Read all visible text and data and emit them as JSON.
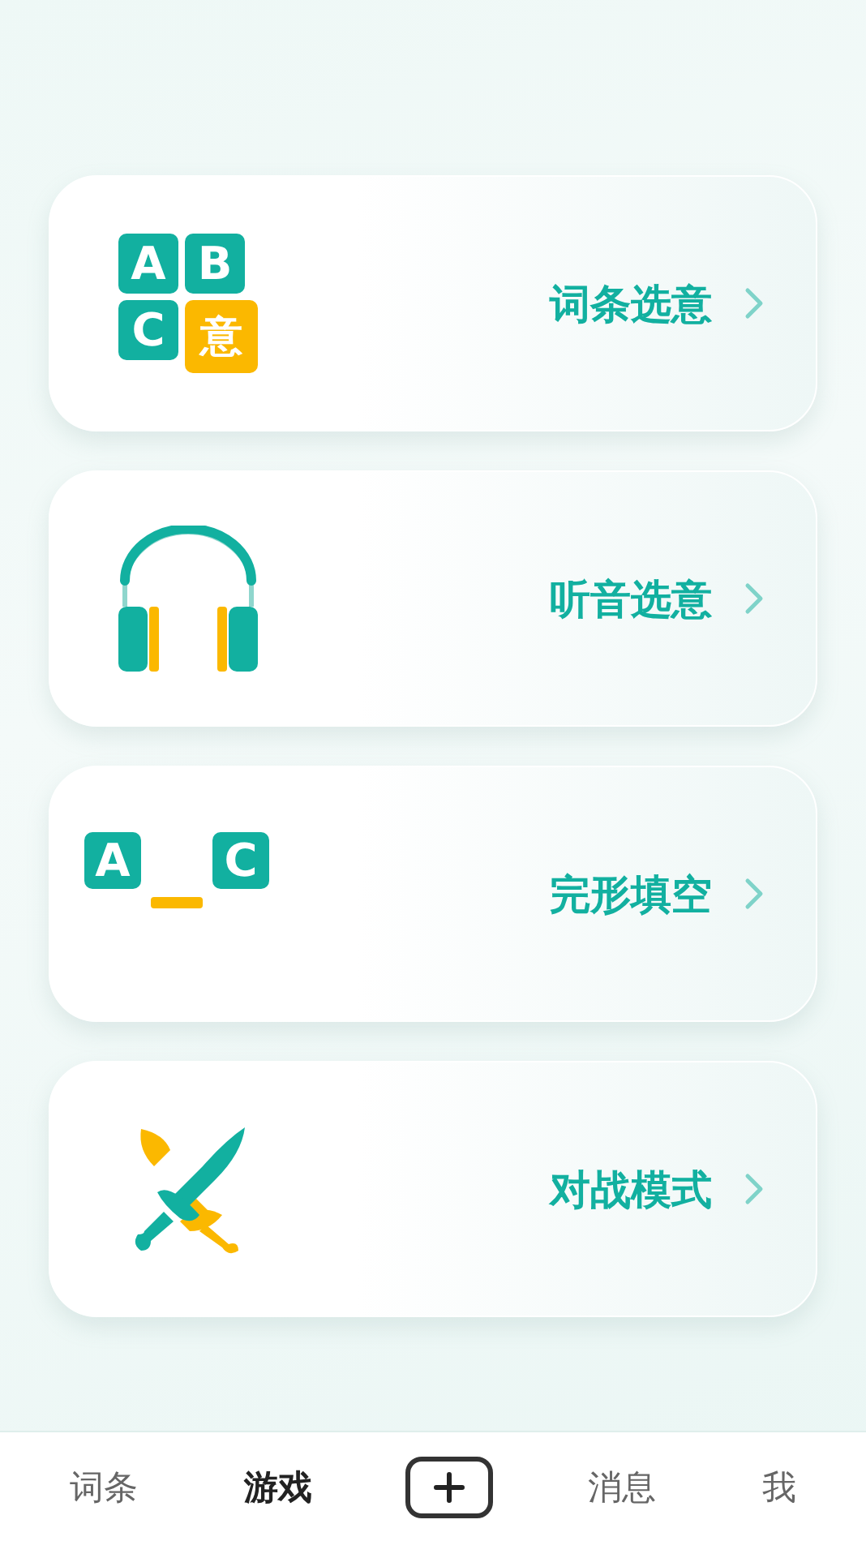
{
  "cards": [
    {
      "kind": "abc",
      "letters": [
        "A",
        "B",
        "C",
        "意"
      ],
      "label": "词条选意"
    },
    {
      "kind": "headphones",
      "label": "听音选意"
    },
    {
      "kind": "cloze",
      "letters": [
        "A",
        "C"
      ],
      "label": "完形填空"
    },
    {
      "kind": "battle",
      "label": "对战模式"
    }
  ],
  "tabs": [
    {
      "kind": "text",
      "label": "词条",
      "selected": false
    },
    {
      "kind": "text",
      "label": "游戏",
      "selected": true
    },
    {
      "kind": "add",
      "selected": false
    },
    {
      "kind": "text",
      "label": "消息",
      "selected": false
    },
    {
      "kind": "text",
      "label": "我",
      "selected": false
    }
  ]
}
